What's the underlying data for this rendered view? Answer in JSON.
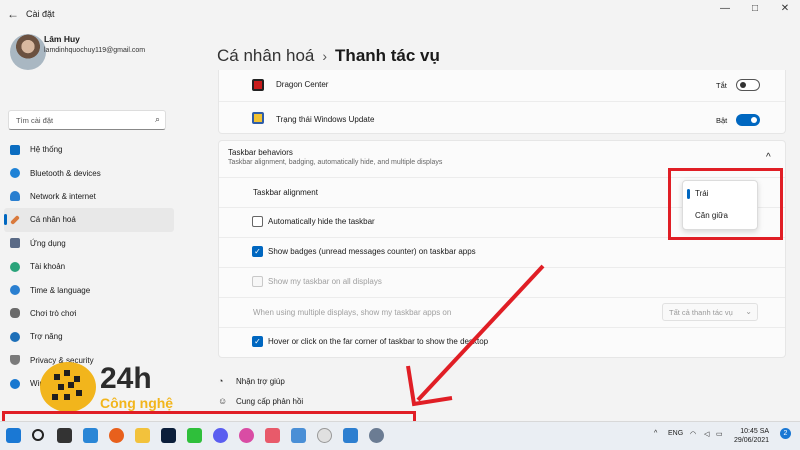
{
  "window": {
    "title": "Cài đặt",
    "back": "←",
    "minimize": "—",
    "maximize": "□",
    "close": "✕"
  },
  "profile": {
    "name": "Lâm Huy",
    "email": "lamdinhquochuy119@gmail.com"
  },
  "search": {
    "placeholder": "Tìm cài đặt"
  },
  "sidebar": {
    "items": [
      {
        "label": "Hệ thống",
        "color": "#0a6cc0"
      },
      {
        "label": "Bluetooth & devices",
        "color": "#1f82d6"
      },
      {
        "label": "Network & internet",
        "color": "#2a7fd0"
      },
      {
        "label": "Cá nhân hoá",
        "color": "#d97a3d"
      },
      {
        "label": "Ứng dụng",
        "color": "#5a6a86"
      },
      {
        "label": "Tài khoản",
        "color": "#2aa37a"
      },
      {
        "label": "Time & language",
        "color": "#2a7fd0"
      },
      {
        "label": "Chơi trò chơi",
        "color": "#6b6b6b"
      },
      {
        "label": "Trợ năng",
        "color": "#1d6fb8"
      },
      {
        "label": "Privacy & security",
        "color": "#7a7a7a"
      },
      {
        "label": "Windows Update",
        "color": "#1878d0"
      }
    ]
  },
  "header": {
    "crumb": "Cá nhân hoá",
    "separator": "›",
    "current": "Thanh tác vụ"
  },
  "tray_apps": [
    {
      "label": "Dragon Center",
      "state": "Tắt"
    },
    {
      "label": "Trạng thái Windows Update",
      "state": "Bật"
    }
  ],
  "behaviors": {
    "title": "Taskbar behaviors",
    "subtitle": "Taskbar alignment, badging, automatically hide, and multiple displays",
    "collapse": "^",
    "alignment_label": "Taskbar alignment",
    "alignment_options": [
      "Trái",
      "Căn giữa"
    ],
    "auto_hide": "Automatically hide the taskbar",
    "badges": "Show badges (unread messages counter) on taskbar apps",
    "all_displays": "Show my taskbar on all displays",
    "multi_display": "When using multiple displays, show my taskbar apps on",
    "multi_display_value": "Tất cả thanh tác vụ",
    "hover_corner": "Hover or click on the far corner of taskbar to show the desktop",
    "check": "✓"
  },
  "links": {
    "help": "Nhận trợ giúp",
    "feedback": "Cung cấp phản hồi"
  },
  "watermark": {
    "number": "24h",
    "text": "Công nghệ"
  },
  "taskbar": {
    "lang": "ENG",
    "time": "10:45 SA",
    "date": "29/06/2021",
    "badge": "2"
  }
}
